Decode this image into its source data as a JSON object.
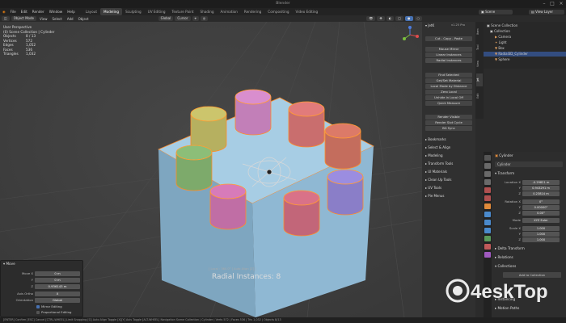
{
  "window": {
    "title": "Blender"
  },
  "menubar": {
    "items": [
      "File",
      "Edit",
      "Render",
      "Window",
      "Help"
    ],
    "workspaces": [
      "Layout",
      "Modeling",
      "Sculpting",
      "UV Editing",
      "Texture Paint",
      "Shading",
      "Animation",
      "Rendering",
      "Compositing",
      "Video Editing"
    ],
    "active_workspace": "Modeling",
    "scene": "Scene",
    "view_layer": "View Layer"
  },
  "viewport_header": {
    "mode": "Object Mode",
    "menus": [
      "View",
      "Select",
      "Add",
      "Object"
    ],
    "transform": "Global",
    "pivot": "Cursor"
  },
  "overlay": {
    "view_name": "User Perspective",
    "collection": "(0) Scene Collection | Cylinder",
    "stats": [
      {
        "label": "Objects",
        "value": "8 / 13"
      },
      {
        "label": "Vertices",
        "value": "572"
      },
      {
        "label": "Edges",
        "value": "1,052"
      },
      {
        "label": "Faces",
        "value": "536"
      },
      {
        "label": "Triangles",
        "value": "1,032"
      }
    ]
  },
  "hint": "[ Local : 360.0° ]   Auto Align [Z] ]",
  "radial_label": "Radial Instances: 8",
  "colors": {
    "cube": "#8fb8d3",
    "selection": "#ff8c2a",
    "accent": "#4772b3"
  },
  "cylinders": [
    {
      "color": "#c27fb8"
    },
    {
      "color": "#c96e6e"
    },
    {
      "color": "#c46d5d"
    },
    {
      "color": "#8a7ec8"
    },
    {
      "color": "#c26679"
    },
    {
      "color": "#c06ea5"
    },
    {
      "color": "#7daa6b"
    },
    {
      "color": "#b6b060"
    }
  ],
  "redo_panel": {
    "title": "Move",
    "rows": [
      {
        "label": "Move X",
        "value": "0 m"
      },
      {
        "label": "Y",
        "value": "0 m"
      },
      {
        "label": "Z",
        "value": "0.936143 m"
      },
      {
        "label": "Axis Ortho",
        "value": "X"
      },
      {
        "label": "Orientation",
        "value": "Global"
      }
    ],
    "checks": [
      "Mirror Editing",
      "Proportional Editing"
    ]
  },
  "npanel": {
    "header": "JetK",
    "version": "v1.25 Pro",
    "tabs": [
      "Item",
      "Tool",
      "View",
      "Jet",
      "Edit"
    ],
    "buttons": [
      "Cut - Copy - Paste",
      "Mouse Mirror",
      "Linear Instances",
      "Radial Instances",
      "Find Selected",
      "Get/Set Material",
      "Local Mode by Distance",
      "Zero Local",
      "Unhide in Local Off",
      "Quick Measure",
      "Render Visible",
      "Render Slot Cycle",
      "BG Sync"
    ],
    "sections": [
      "Bookmarks",
      "Select & Align",
      "Modeling",
      "Transform Tools",
      "UI Materials",
      "Clean Up Tools",
      "UV Tools",
      "Pie Menus"
    ]
  },
  "outliner": {
    "root": "Scene Collection",
    "items": [
      "Collection",
      "Camera",
      "Light",
      "Box",
      "Radial3D_Cylinder",
      "Sphere"
    ]
  },
  "properties": {
    "object": "Cylinder",
    "data": "Cylinder",
    "section": "Transform",
    "location": [
      "-0.29821 m",
      "0.943291 m",
      "0.23814 m"
    ],
    "rotation": [
      "0°",
      "0.00000°",
      "0.00°"
    ],
    "mode": "XYZ Euler",
    "scale": [
      "1.000",
      "1.000",
      "1.000"
    ],
    "subsections": [
      "Delta Transform",
      "Relations",
      "Collections",
      "Instancing",
      "Motion Paths"
    ],
    "add_collection": "Add to Collection"
  },
  "statusbar": {
    "text": "[ENTER] Confirm   [ESC] Cancel   [CTRL-WHEEL] Limit Snapping   [G] Auto Align Toggle   [X][Y] Axis Toggle   [ALT-WHEEL] Navigation   Scene Collection | Cylinder | Verts 572 | Faces 536 | Tris 1,032 | Objects 8/13"
  },
  "watermark": {
    "brand": "4eskTop"
  }
}
